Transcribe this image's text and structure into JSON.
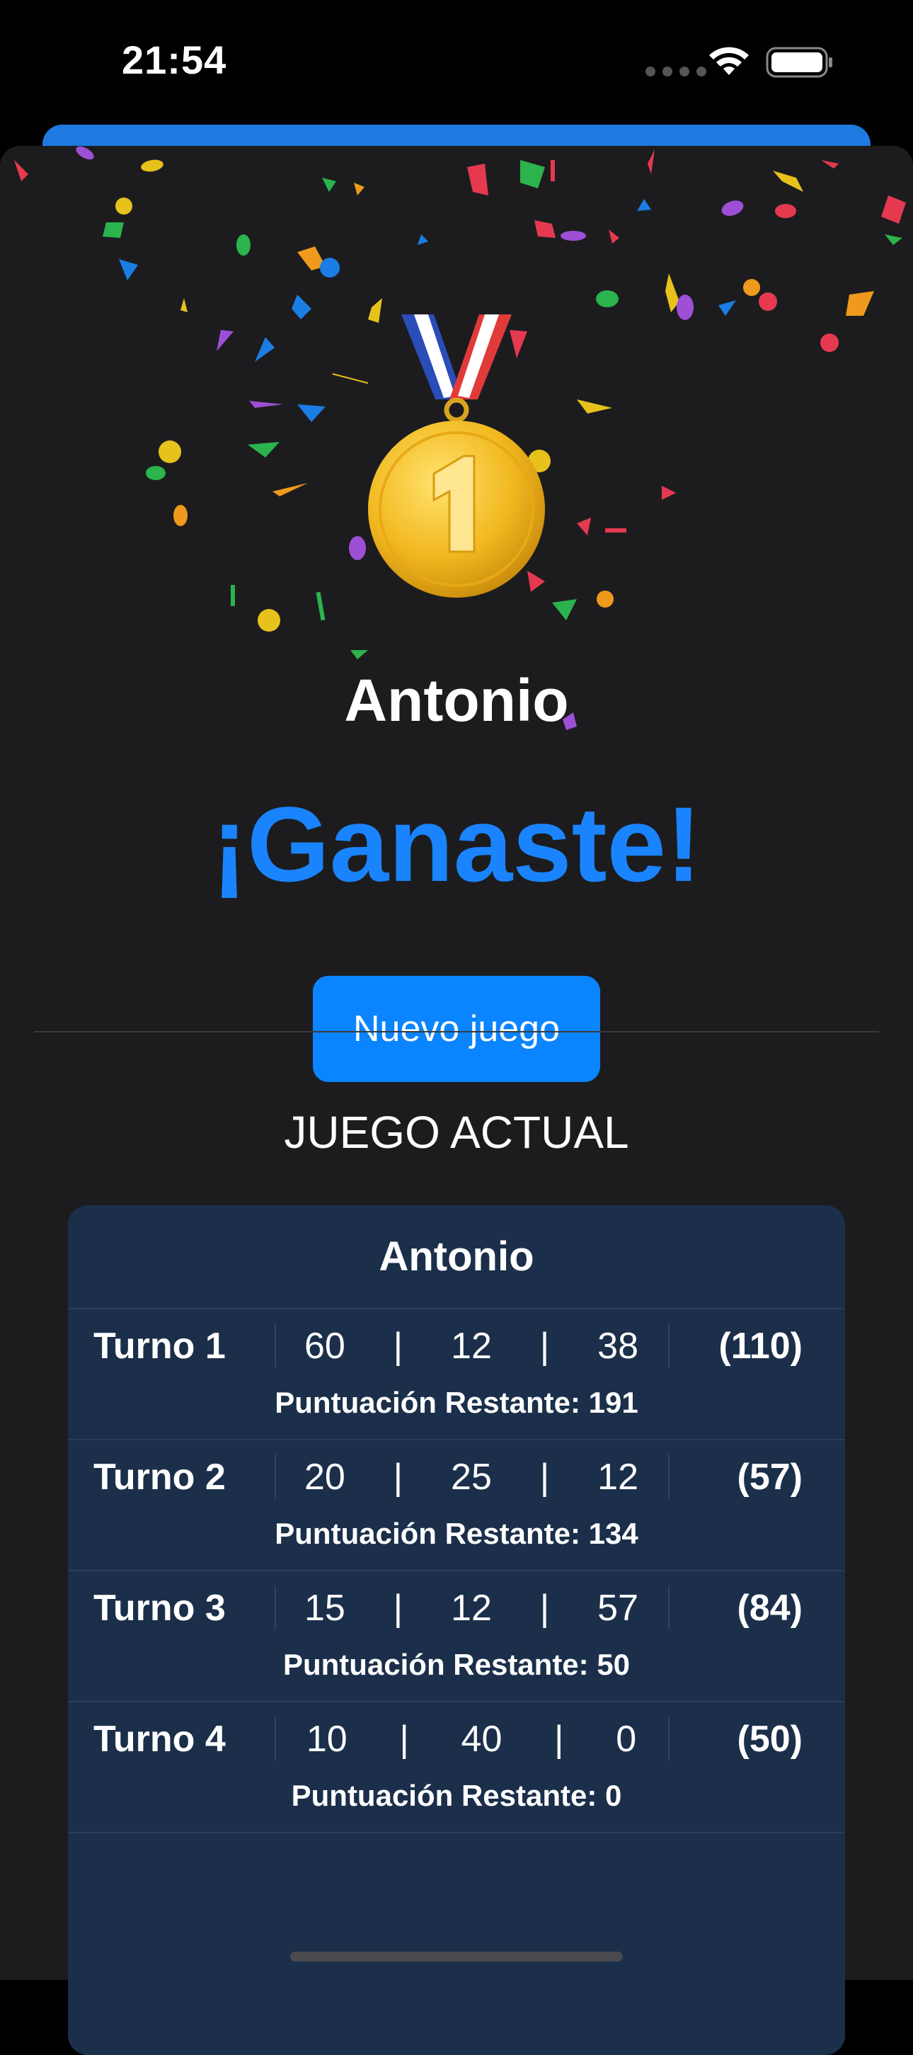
{
  "status": {
    "time": "21:54"
  },
  "winner": {
    "name": "Antonio",
    "title": "¡Ganaste!"
  },
  "actions": {
    "new_game": "Nuevo juego"
  },
  "section": {
    "title": "JUEGO ACTUAL"
  },
  "card": {
    "player": "Antonio",
    "turns": [
      {
        "label": "Turno 1",
        "throws": [
          "60",
          "12",
          "38"
        ],
        "total": "(110)",
        "remaining": "Puntuación Restante: 191"
      },
      {
        "label": "Turno 2",
        "throws": [
          "20",
          "25",
          "12"
        ],
        "total": "(57)",
        "remaining": "Puntuación Restante: 134"
      },
      {
        "label": "Turno 3",
        "throws": [
          "15",
          "12",
          "57"
        ],
        "total": "(84)",
        "remaining": "Puntuación Restante: 50"
      },
      {
        "label": "Turno 4",
        "throws": [
          "10",
          "40",
          "0"
        ],
        "total": "(50)",
        "remaining": "Puntuación Restante: 0"
      }
    ],
    "separator": "|"
  },
  "icons": {
    "medal": "first-place-medal-icon",
    "wifi": "wifi-icon",
    "battery": "battery-icon"
  },
  "colors": {
    "accent": "#0a84ff",
    "card": "#1b2f4a",
    "background": "#1c1c1e"
  }
}
